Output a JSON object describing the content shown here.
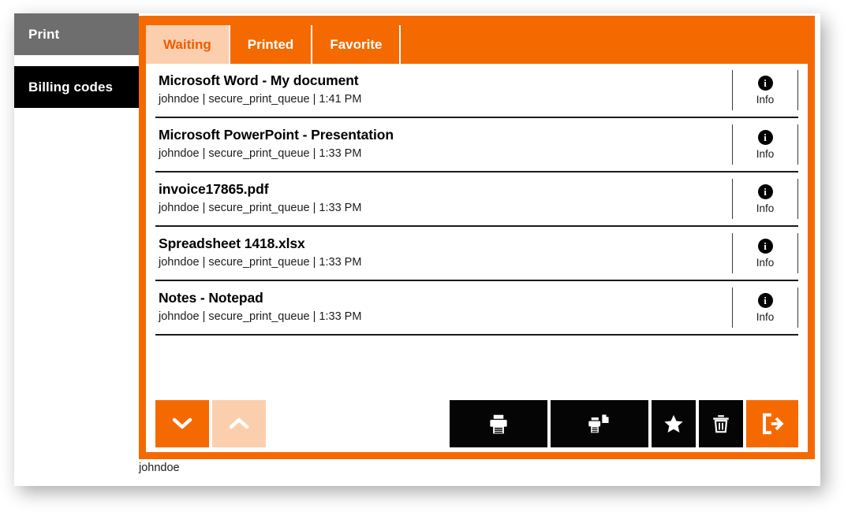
{
  "sidebar": {
    "items": [
      {
        "label": "Print",
        "state": "selected"
      },
      {
        "label": "Billing codes",
        "state": "normal"
      }
    ]
  },
  "tabs": [
    {
      "label": "Waiting",
      "active": true
    },
    {
      "label": "Printed",
      "active": false
    },
    {
      "label": "Favorite",
      "active": false
    }
  ],
  "jobs": [
    {
      "title": "Microsoft Word - My document",
      "user": "johndoe",
      "queue": "secure_print_queue",
      "time": "1:41 PM",
      "meta": "johndoe | secure_print_queue | 1:41 PM",
      "info_label": "Info"
    },
    {
      "title": "Microsoft PowerPoint - Presentation",
      "user": "johndoe",
      "queue": "secure_print_queue",
      "time": "1:33 PM",
      "meta": "johndoe | secure_print_queue | 1:33 PM",
      "info_label": "Info"
    },
    {
      "title": "invoice17865.pdf",
      "user": "johndoe",
      "queue": "secure_print_queue",
      "time": "1:33 PM",
      "meta": "johndoe | secure_print_queue | 1:33 PM",
      "info_label": "Info"
    },
    {
      "title": "Spreadsheet 1418.xlsx",
      "user": "johndoe",
      "queue": "secure_print_queue",
      "time": "1:33 PM",
      "meta": "johndoe | secure_print_queue | 1:33 PM",
      "info_label": "Info"
    },
    {
      "title": "Notes - Notepad",
      "user": "johndoe",
      "queue": "secure_print_queue",
      "time": "1:33 PM",
      "meta": "johndoe | secure_print_queue | 1:33 PM",
      "info_label": "Info"
    }
  ],
  "toolbar": {
    "scroll_down_icon": "chevron-down-icon",
    "scroll_up_icon": "chevron-up-icon",
    "actions": [
      {
        "icon": "printer-icon",
        "name": "print-button"
      },
      {
        "icon": "printer-copy-icon",
        "name": "print-and-keep-button"
      },
      {
        "icon": "star-icon",
        "name": "favorite-button"
      },
      {
        "icon": "trash-icon",
        "name": "delete-button"
      },
      {
        "icon": "logout-icon",
        "name": "logout-button"
      }
    ]
  },
  "footer": {
    "user": "johndoe"
  },
  "colors": {
    "accent_orange": "#f56a00",
    "light_orange": "#fbcfad",
    "sidebar_selected_gray": "#6e6e6e",
    "sidebar_black": "#000000",
    "button_black": "#050505",
    "white": "#ffffff"
  }
}
